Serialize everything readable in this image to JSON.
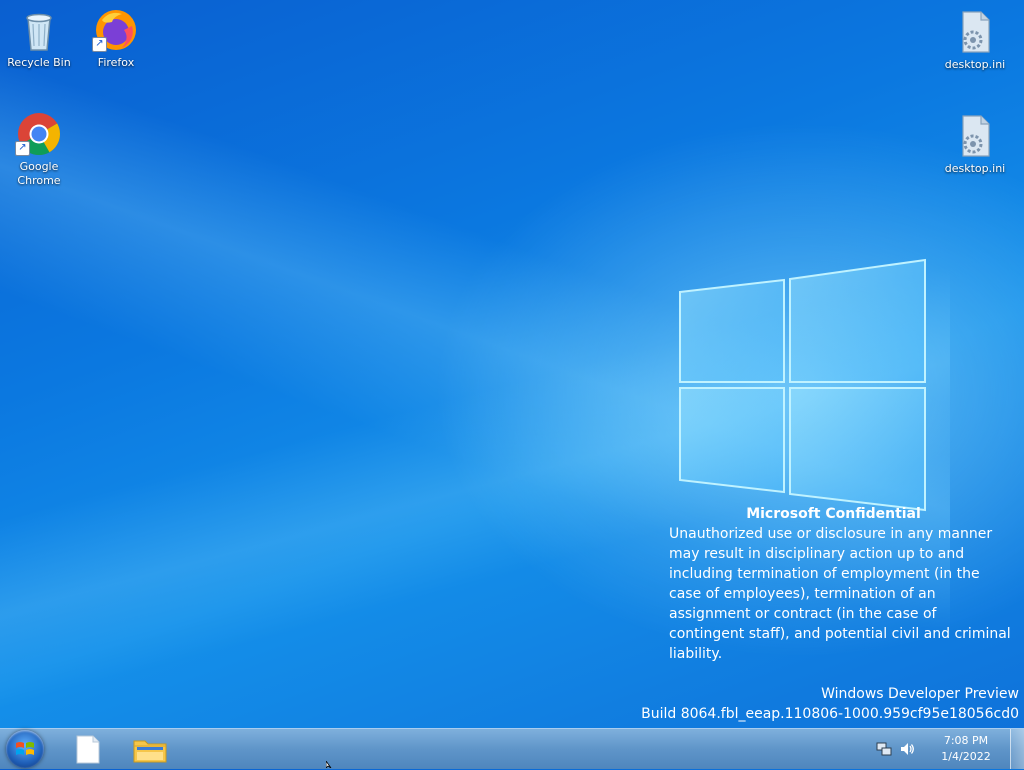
{
  "desktop": {
    "icons": [
      {
        "label": "Recycle Bin"
      },
      {
        "label": "Firefox"
      },
      {
        "label": "Google Chrome"
      },
      {
        "label": "desktop.ini"
      },
      {
        "label": "desktop.ini"
      }
    ]
  },
  "overlay": {
    "confidential_title": "Microsoft Confidential",
    "confidential_body": "Unauthorized use or disclosure in any manner may result in disciplinary action up to and including termination of employment (in the case of employees), termination of an assignment or contract (in the case of contingent staff), and potential civil and criminal liability.",
    "edition": "Windows Developer Preview",
    "build": "Build 8064.fbl_eeap.110806-1000.959cf95e18056cd0"
  },
  "taskbar": {
    "time": "7:08 PM",
    "date": "1/4/2022",
    "pinned": [
      "document-icon",
      "file-explorer-icon"
    ],
    "tray_icons": [
      "network-icon",
      "volume-icon"
    ]
  },
  "colors": {
    "wallpaper": "#0b78e0",
    "taskbar": "#5f95c9",
    "text": "#ffffff"
  }
}
